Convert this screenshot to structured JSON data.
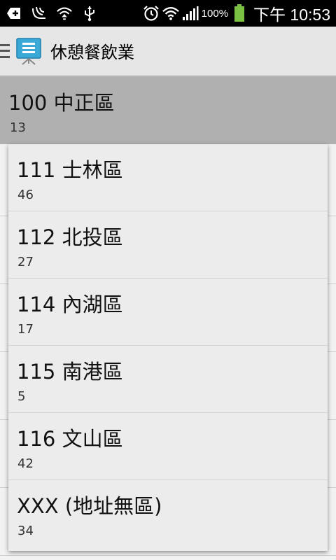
{
  "status_bar": {
    "battery_percent": "100%",
    "time": "下午 10:53",
    "icons": [
      "add-notification-icon",
      "kik-icon",
      "wifi-upload-icon",
      "usb-icon",
      "alarm-icon",
      "wifi-icon",
      "signal-icon",
      "battery-icon"
    ]
  },
  "action_bar": {
    "title": "休憩餐飲業",
    "icon": "presentation-board-icon"
  },
  "selected": {
    "title": "100 中正區",
    "count": "13"
  },
  "popup_items": [
    {
      "title": "111 士林區",
      "count": "46"
    },
    {
      "title": "112 北投區",
      "count": "27"
    },
    {
      "title": "114 內湖區",
      "count": "17"
    },
    {
      "title": "115 南港區",
      "count": "5"
    },
    {
      "title": "116 文山區",
      "count": "42"
    },
    {
      "title": "XXX (地址無區)",
      "count": "34"
    }
  ],
  "colors": {
    "status_bar": "#000000",
    "action_bar": "#e6e6e6",
    "selected_row": "#b0b0b0",
    "popup": "#ececec",
    "battery": "#7ac143"
  }
}
